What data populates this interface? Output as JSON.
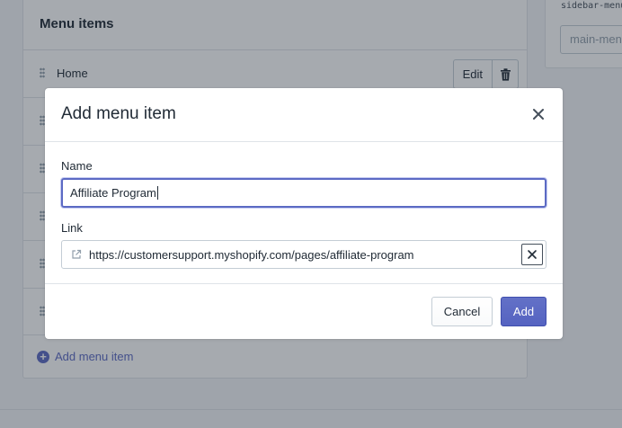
{
  "background": {
    "menu_card": {
      "title": "Menu items",
      "items": [
        {
          "label": "Home",
          "edit_label": "Edit"
        },
        {
          "label": ""
        },
        {
          "label": ""
        },
        {
          "label": ""
        },
        {
          "label": ""
        },
        {
          "label": ""
        }
      ],
      "add_item_label": "Add menu item"
    },
    "side_card": {
      "handle_code": "sidebar-menu",
      "handle_value": "main-menu"
    }
  },
  "modal": {
    "title": "Add menu item",
    "name_label": "Name",
    "name_value": "Affiliate Program",
    "link_label": "Link",
    "link_value": "https://customersupport.myshopify.com/pages/affiliate-program",
    "cancel_label": "Cancel",
    "add_label": "Add"
  },
  "colors": {
    "accent": "#5c6ac4",
    "overlay": "rgba(33,43,54,0.40)"
  },
  "icons": [
    "drag-handle-icon",
    "trash-icon",
    "plus-circle-icon",
    "close-icon",
    "external-link-icon",
    "clear-icon"
  ]
}
